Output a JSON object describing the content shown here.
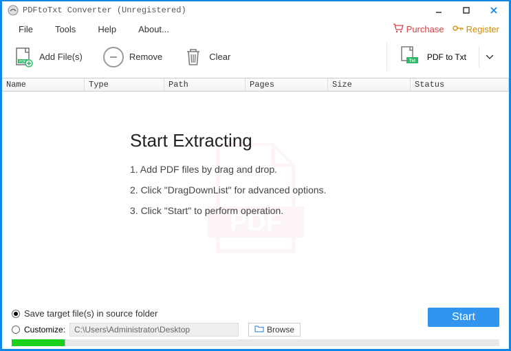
{
  "title": "PDFtoTxt Converter (Unregistered)",
  "menu": {
    "file": "File",
    "tools": "Tools",
    "help": "Help",
    "about": "About..."
  },
  "rlinks": {
    "purchase": "Purchase",
    "register": "Register"
  },
  "toolbar": {
    "add": "Add File(s)",
    "remove": "Remove",
    "clear": "Clear",
    "convert": "PDF to Txt"
  },
  "columns": {
    "name": "Name",
    "type": "Type",
    "path": "Path",
    "pages": "Pages",
    "size": "Size",
    "status": "Status"
  },
  "instructions": {
    "heading": "Start Extracting",
    "step1": "1. Add PDF files by drag and drop.",
    "step2": "2. Click \"DragDownList\" for advanced options.",
    "step3": "3. Click \"Start\" to perform operation."
  },
  "bottom": {
    "save_source": "Save target file(s) in source folder",
    "customize": "Customize:",
    "path": "C:\\Users\\Administrator\\Desktop",
    "browse": "Browse",
    "start": "Start"
  },
  "watermark_label": "PDF"
}
